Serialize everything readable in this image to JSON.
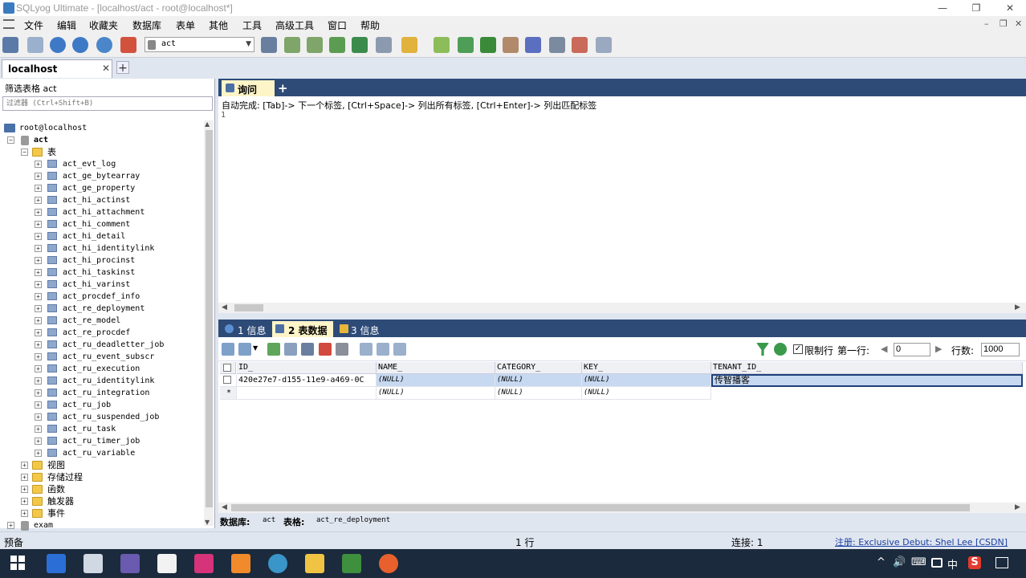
{
  "window": {
    "title": "SQLyog Ultimate - [localhost/act - root@localhost*]",
    "min": "—",
    "restore": "❐",
    "close": "✕"
  },
  "menu": {
    "items": [
      "文件",
      "编辑",
      "收藏夹",
      "数据库",
      "表单",
      "其他",
      "工具",
      "高级工具",
      "窗口",
      "帮助"
    ],
    "mdi_min": "–",
    "mdi_restore": "❐",
    "mdi_close": "✕"
  },
  "toolbar": {
    "database": "act"
  },
  "connection_tab": {
    "label": "localhost",
    "close": "✕",
    "add": "+"
  },
  "filter": {
    "label": "筛选表格 act",
    "placeholder": "过滤器 (Ctrl+Shift+B)"
  },
  "tree": {
    "root": "root@localhost",
    "db": "act",
    "tables_folder": "表",
    "tables": [
      "act_evt_log",
      "act_ge_bytearray",
      "act_ge_property",
      "act_hi_actinst",
      "act_hi_attachment",
      "act_hi_comment",
      "act_hi_detail",
      "act_hi_identitylink",
      "act_hi_procinst",
      "act_hi_taskinst",
      "act_hi_varinst",
      "act_procdef_info",
      "act_re_deployment",
      "act_re_model",
      "act_re_procdef",
      "act_ru_deadletter_job",
      "act_ru_event_subscr",
      "act_ru_execution",
      "act_ru_identitylink",
      "act_ru_integration",
      "act_ru_job",
      "act_ru_suspended_job",
      "act_ru_task",
      "act_ru_timer_job",
      "act_ru_variable"
    ],
    "folders": [
      "视图",
      "存储过程",
      "函数",
      "触发器",
      "事件"
    ],
    "next_db": "exam"
  },
  "query_tab": {
    "label": "询问",
    "add": "+"
  },
  "editor": {
    "hint": "自动完成: [Tab]-> 下一个标签, [Ctrl+Space]-> 列出所有标签, [Ctrl+Enter]-> 列出匹配标签",
    "line": "1"
  },
  "result_tabs": [
    {
      "label": "1 信息"
    },
    {
      "label": "2 表数据"
    },
    {
      "label": "3 信息"
    }
  ],
  "result_toolbar": {
    "limit_label": "限制行",
    "first_row_label": "第一行:",
    "first_row_value": "0",
    "rows_label": "行数:",
    "rows_value": "1000",
    "check": "✓"
  },
  "grid": {
    "columns": [
      "ID_",
      "NAME_",
      "CATEGORY_",
      "KEY_",
      "TENANT_ID_"
    ],
    "rows": [
      [
        "420e27e7-d155-11e9-a469-0C",
        "(NULL)",
        "(NULL)",
        "(NULL)",
        "传智播客"
      ]
    ],
    "new_row": [
      "(NULL)",
      "(NULL)",
      "(NULL)"
    ],
    "new_row_marker": "*"
  },
  "info": {
    "db_label": "数据库:",
    "db_value": "act",
    "table_label": "表格:",
    "table_value": "act_re_deployment"
  },
  "status": {
    "left": "预备",
    "rows": "1 行",
    "connection": "连接: 1",
    "register": "注册: Exclusive Debut: Shel Lee [CSDN]"
  },
  "taskbar": {
    "tray_icons": [
      "^",
      "🔊",
      "⌨",
      "中",
      "S"
    ]
  },
  "colors": {
    "accent": "#2e4b78",
    "selected_tab": "#fdf5c8",
    "selection": "#c7d9f1"
  }
}
